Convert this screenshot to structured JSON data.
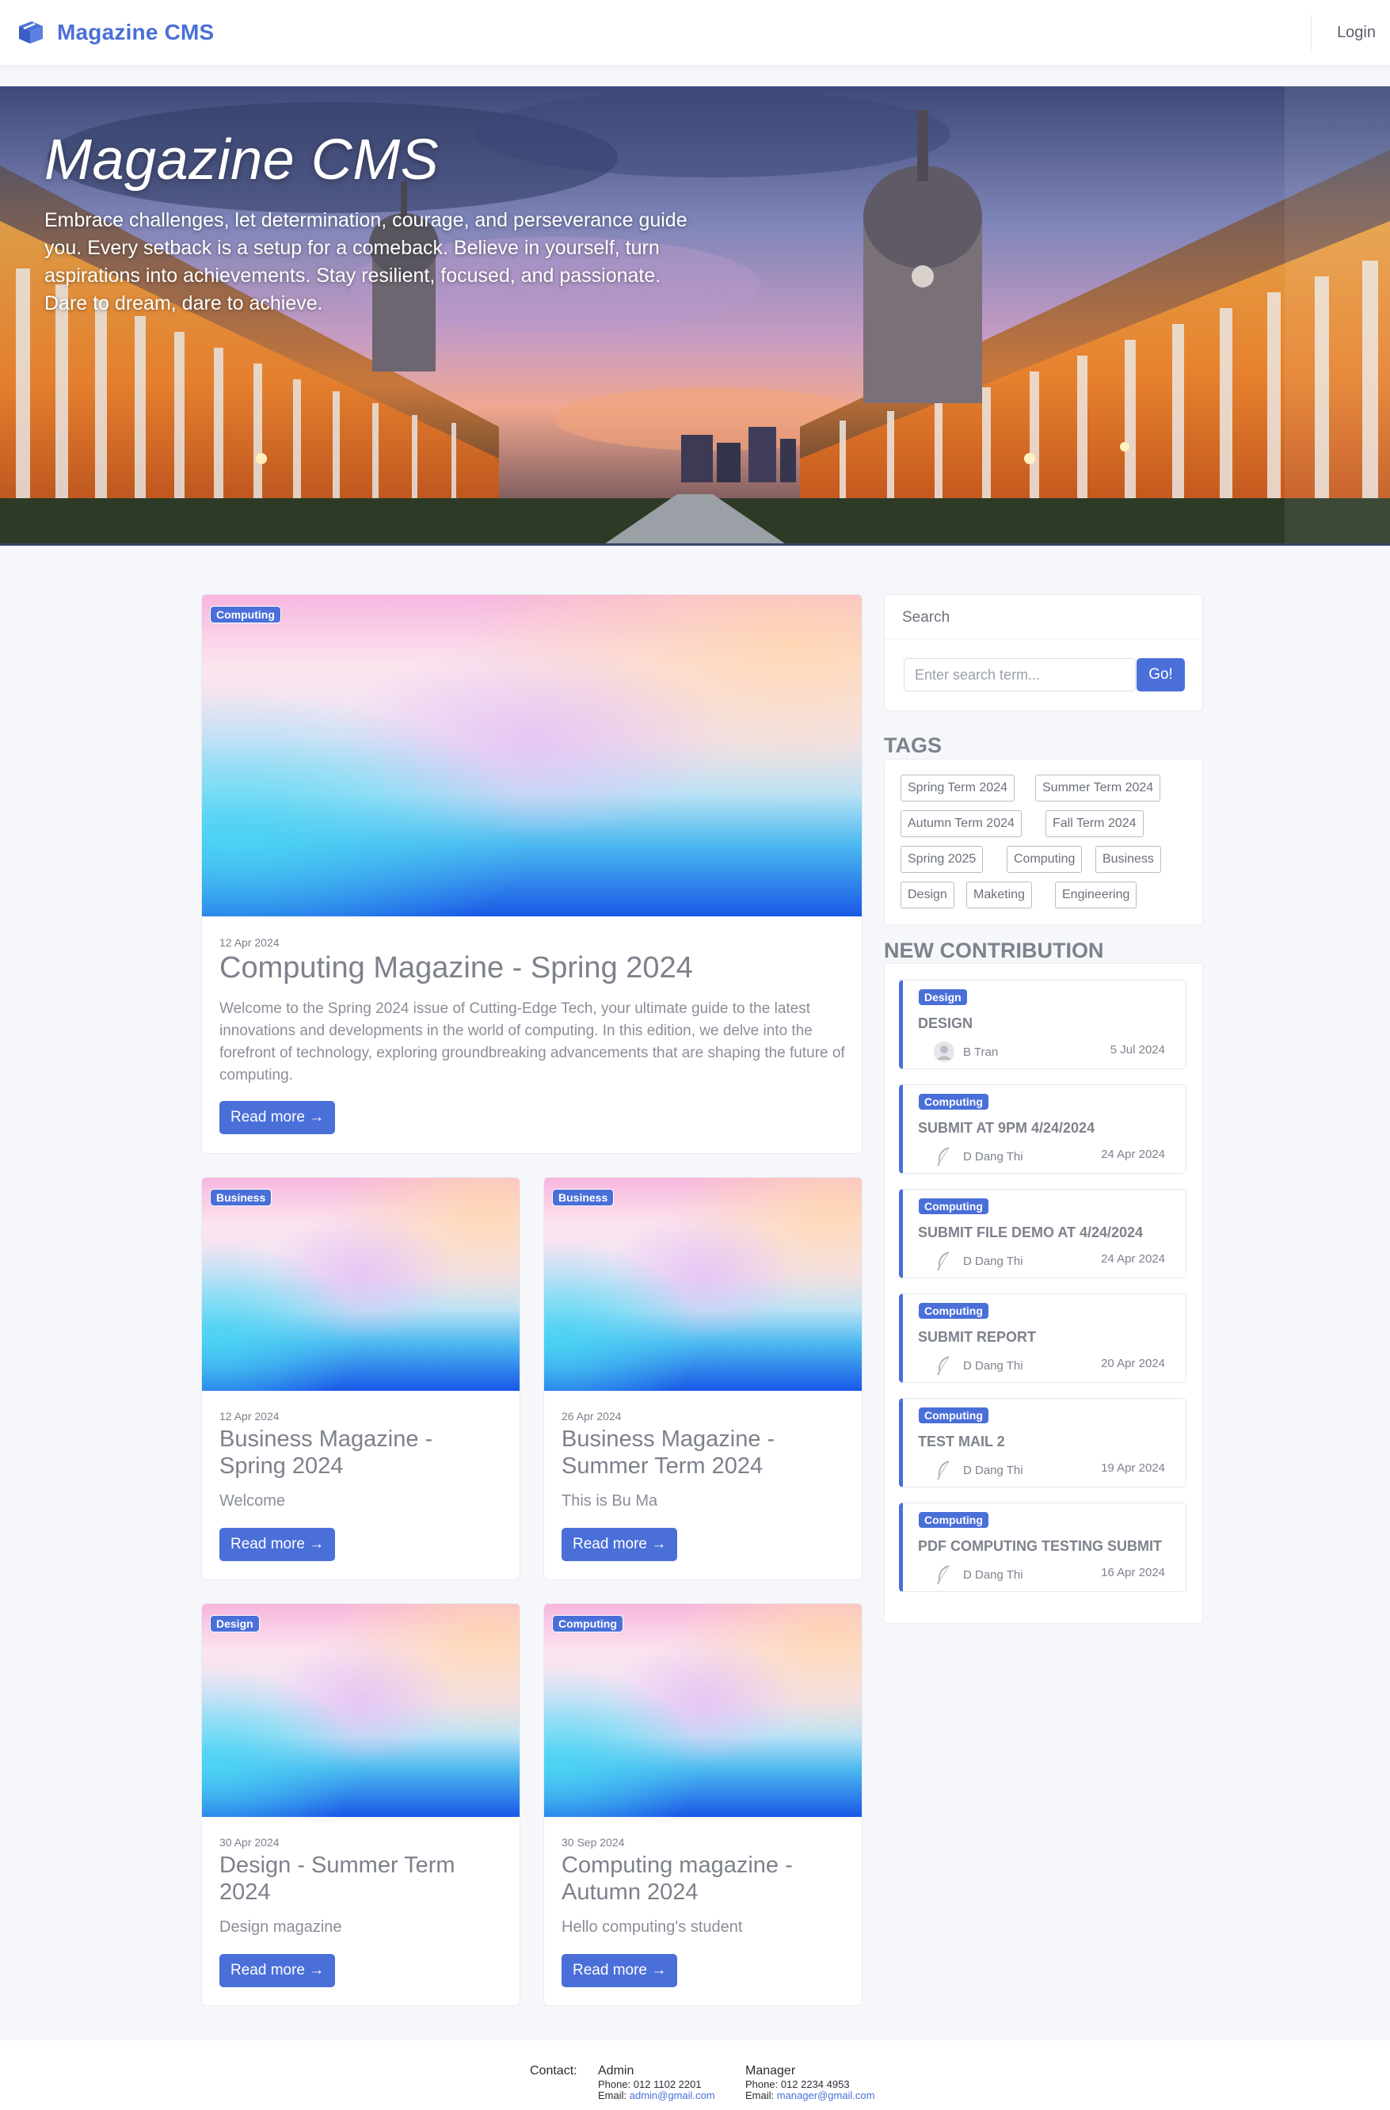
{
  "navbar": {
    "brand": "Magazine CMS",
    "login": "Login"
  },
  "hero": {
    "title": "Magazine CMS",
    "text": "Embrace challenges, let determination, courage, and perseverance guide you. Every setback is a setup for a comeback. Believe in yourself, turn aspirations into achievements. Stay resilient, focused, and passionate. Dare to dream, dare to achieve."
  },
  "featured": {
    "tag": "Computing",
    "date": "12 Apr 2024",
    "title": "Computing Magazine - Spring 2024",
    "description": "Welcome to the Spring 2024 issue of Cutting-Edge Tech, your ultimate guide to the latest innovations and developments in the world of computing. In this edition, we delve into the forefront of technology, exploring groundbreaking advancements that are shaping the future of computing.",
    "read_more": "Read more →"
  },
  "articles": [
    {
      "tag": "Business",
      "date": "12 Apr 2024",
      "title": "Business Magazine - Spring 2024",
      "description": "Welcome",
      "read_more": "Read more →"
    },
    {
      "tag": "Business",
      "date": "26 Apr 2024",
      "title": "Business Magazine - Summer Term 2024",
      "description": "This is Bu Ma",
      "read_more": "Read more →"
    },
    {
      "tag": "Design",
      "date": "30 Apr 2024",
      "title": "Design - Summer Term 2024",
      "description": "Design magazine",
      "read_more": "Read more →"
    },
    {
      "tag": "Computing",
      "date": "30 Sep 2024",
      "title": "Computing magazine - Autumn 2024",
      "description": "Hello computing's student",
      "read_more": "Read more →"
    }
  ],
  "search": {
    "heading": "Search",
    "placeholder": "Enter search term...",
    "button": "Go!"
  },
  "tags": {
    "heading": "TAGS",
    "items": [
      "Spring Term 2024",
      "Summer Term 2024",
      "Autumn Term 2024",
      "Fall Term 2024",
      "Spring 2025",
      "Computing",
      "Business",
      "Design",
      "Maketing",
      "Engineering"
    ]
  },
  "contributions": {
    "heading": "NEW CONTRIBUTION",
    "items": [
      {
        "tag": "Design",
        "title": "DESIGN",
        "author": "B Tran",
        "date": "5 Jul 2024",
        "avatar": "user-avatar-icon"
      },
      {
        "tag": "Computing",
        "title": "SUBMIT AT 9PM 4/24/2024",
        "author": "D Dang Thi",
        "date": "24 Apr 2024",
        "avatar": "feather-avatar-icon"
      },
      {
        "tag": "Computing",
        "title": "SUBMIT FILE DEMO AT 4/24/2024",
        "author": "D Dang Thi",
        "date": "24 Apr 2024",
        "avatar": "feather-avatar-icon"
      },
      {
        "tag": "Computing",
        "title": "SUBMIT REPORT",
        "author": "D Dang Thi",
        "date": "20 Apr 2024",
        "avatar": "feather-avatar-icon"
      },
      {
        "tag": "Computing",
        "title": "TEST MAIL 2",
        "author": "D Dang Thi",
        "date": "19 Apr 2024",
        "avatar": "feather-avatar-icon"
      },
      {
        "tag": "Computing",
        "title": "PDF COMPUTING TESTING SUBMIT",
        "author": "D Dang Thi",
        "date": "16 Apr 2024",
        "avatar": "feather-avatar-icon"
      }
    ]
  },
  "footer": {
    "contact_label": "Contact:",
    "admin": {
      "name": "Admin",
      "phone": "Phone: 012 1102 2201",
      "email_label": "Email:",
      "email": "admin@gmail.com"
    },
    "manager": {
      "name": "Manager",
      "phone": "Phone: 012 2234 4953",
      "email_label": "Email:",
      "email": "manager@gmail.com"
    }
  },
  "colors": {
    "accent": "#4a6fd8",
    "background": "#f6f7fb",
    "text": "#5a5f6b"
  }
}
